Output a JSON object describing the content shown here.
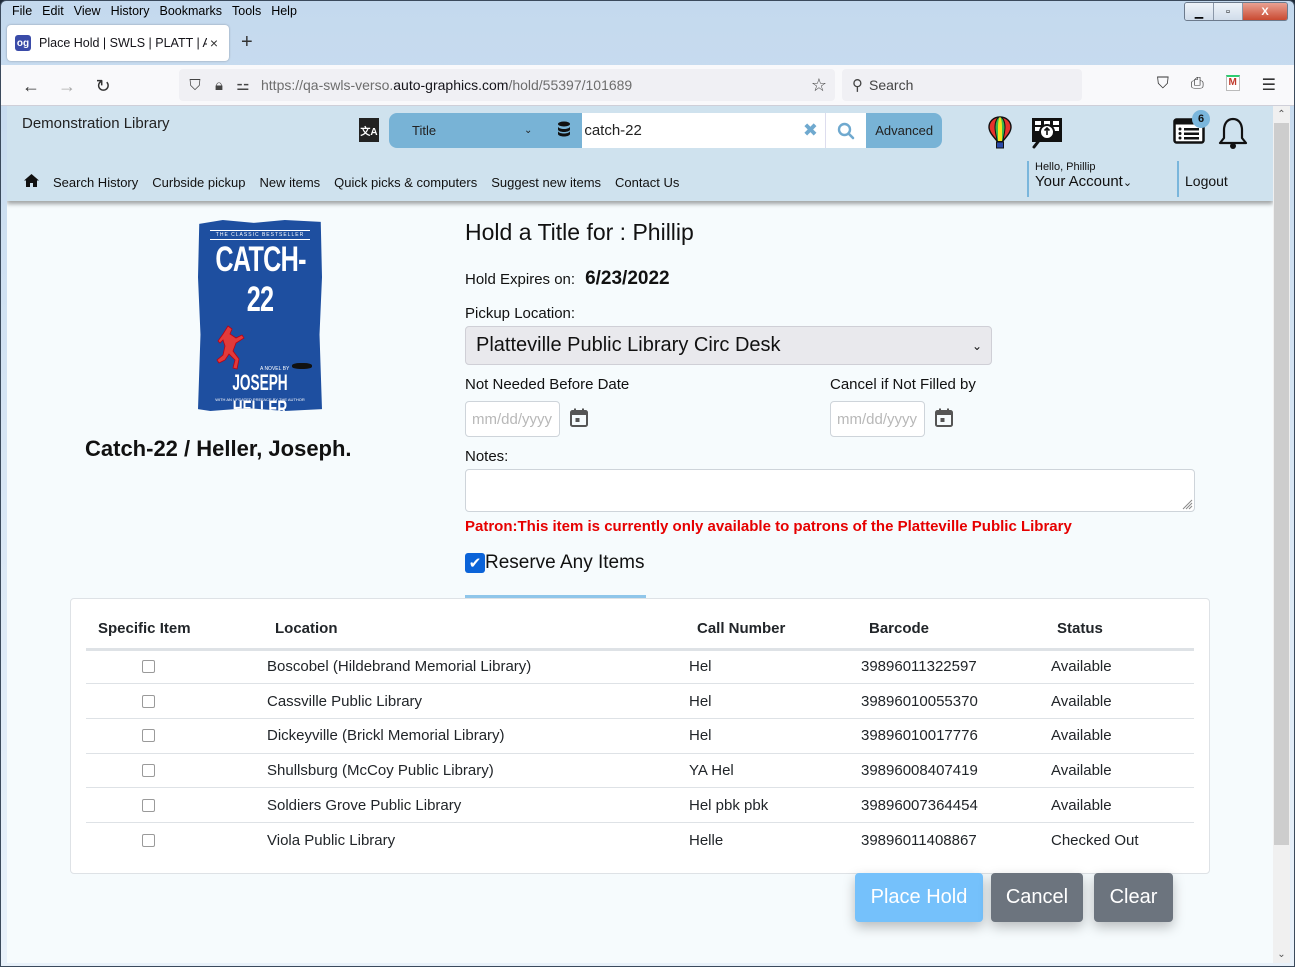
{
  "browser": {
    "menu": [
      "File",
      "Edit",
      "View",
      "History",
      "Bookmarks",
      "Tools",
      "Help"
    ],
    "tab": {
      "title": "Place Hold | SWLS | PLATT | Aut",
      "favicon": "og"
    },
    "url": {
      "prefix": "https://qa-swls-verso.",
      "domain": "auto-graphics.com",
      "path": "/hold/55397/101689"
    },
    "search_placeholder": "Search",
    "window_controls": {
      "minimize": "▁",
      "restore": "▫",
      "close": "X"
    }
  },
  "header": {
    "library_name": "Demonstration Library",
    "search": {
      "type_label": "Title",
      "query": "catch-22",
      "advanced_label": "Advanced"
    },
    "notification_badge": "6",
    "nav_links": [
      "Search History",
      "Curbside pickup",
      "New items",
      "Quick picks & computers",
      "Suggest new items",
      "Contact Us"
    ],
    "greeting": "Hello, Phillip",
    "account_label": "Your Account",
    "logout_label": "Logout"
  },
  "book": {
    "cover": {
      "tagline": "THE CLASSIC BESTSELLER",
      "title": "CATCH-22",
      "novel_by": "A NOVEL BY",
      "author": "JOSEPH HELLER",
      "preface": "WITH AN UPDATED PREFACE BY THE AUTHOR"
    },
    "display_title": "Catch-22 / Heller, Joseph."
  },
  "hold_form": {
    "heading": "Hold a Title for : Phillip",
    "expires_label": "Hold Expires on:",
    "expires_date": "6/23/2022",
    "pickup_label": "Pickup Location:",
    "pickup_value": "Platteville Public Library Circ Desk",
    "not_needed_label": "Not Needed Before Date",
    "cancel_if_label": "Cancel if Not Filled by",
    "date_placeholder": "mm/dd/yyyy",
    "notes_label": "Notes:",
    "notes_value": "",
    "patron_message": "Patron:This item is currently only available to patrons of the Platteville Public Library",
    "reserve_any_label": "Reserve Any Items",
    "reserve_any_checked": true
  },
  "items_table": {
    "headers": [
      "Specific Item",
      "Location",
      "Call Number",
      "Barcode",
      "Status"
    ],
    "rows": [
      {
        "location": "Boscobel (Hildebrand Memorial Library)",
        "call_number": "Hel",
        "barcode": "39896011322597",
        "status": "Available"
      },
      {
        "location": "Cassville Public Library",
        "call_number": "Hel",
        "barcode": "39896010055370",
        "status": "Available"
      },
      {
        "location": "Dickeyville (Brickl Memorial Library)",
        "call_number": "Hel",
        "barcode": "39896010017776",
        "status": "Available"
      },
      {
        "location": "Shullsburg (McCoy Public Library)",
        "call_number": "YA Hel",
        "barcode": "39896008407419",
        "status": "Available"
      },
      {
        "location": "Soldiers Grove Public Library",
        "call_number": "Hel pbk pbk",
        "barcode": "39896007364454",
        "status": "Available"
      },
      {
        "location": "Viola Public Library",
        "call_number": "Helle",
        "barcode": "39896011408867",
        "status": "Checked Out"
      }
    ]
  },
  "buttons": {
    "place_hold": "Place Hold",
    "cancel": "Cancel",
    "clear": "Clear"
  },
  "colors": {
    "header_bg": "#cfe2ee",
    "search_accent": "#78b3d6",
    "place_hold_bg": "#75c1fb",
    "secondary_btn_bg": "#6c747e",
    "error_text": "#e60000",
    "checkbox_checked": "#0b63d8"
  }
}
